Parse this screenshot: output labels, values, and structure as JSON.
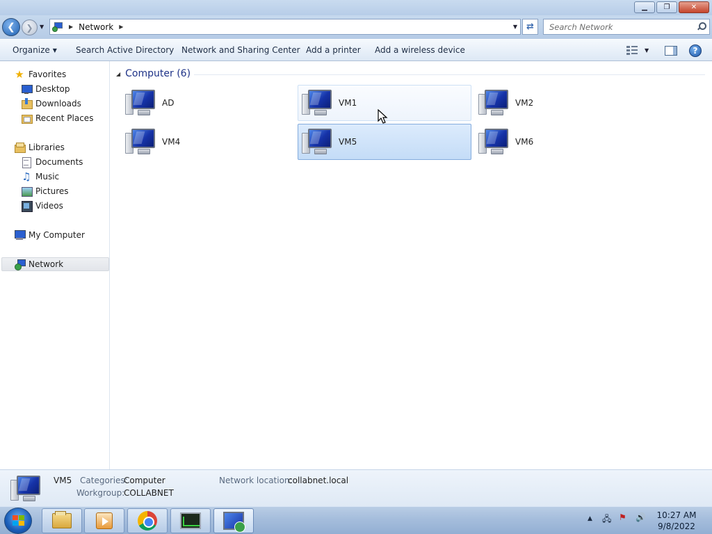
{
  "window": {
    "minimize_glyph": "▁",
    "restore_glyph": "❐",
    "close_glyph": "✕"
  },
  "addressbar": {
    "crumb": "Network",
    "search_placeholder": "Search Network"
  },
  "commandbar": {
    "organize": "Organize",
    "search_ad": "Search Active Directory",
    "network_sharing": "Network and Sharing Center",
    "add_printer": "Add a printer",
    "add_wireless": "Add a wireless device"
  },
  "navpane": {
    "favorites": "Favorites",
    "desktop": "Desktop",
    "downloads": "Downloads",
    "recent_places": "Recent Places",
    "libraries": "Libraries",
    "documents": "Documents",
    "music": "Music",
    "pictures": "Pictures",
    "videos": "Videos",
    "my_computer": "My Computer",
    "network": "Network"
  },
  "content": {
    "group_header": "Computer (6)",
    "computers": [
      "AD",
      "VM1",
      "VM2",
      "VM4",
      "VM5",
      "VM6"
    ],
    "selected": "VM5",
    "hovered": "VM1"
  },
  "details": {
    "name": "VM5",
    "categories_label": "Categories:",
    "categories_value": "Computer",
    "workgroup_label": "Workgroup:",
    "workgroup_value": "COLLABNET",
    "network_location_label": "Network location:",
    "network_location_value": "collabnet.local"
  },
  "taskbar": {
    "time": "10:27 AM",
    "date": "9/8/2022"
  },
  "colors": {
    "accent": "#1e3287",
    "selection": "#c4dcf7",
    "titlebar": "#c9dbef"
  }
}
